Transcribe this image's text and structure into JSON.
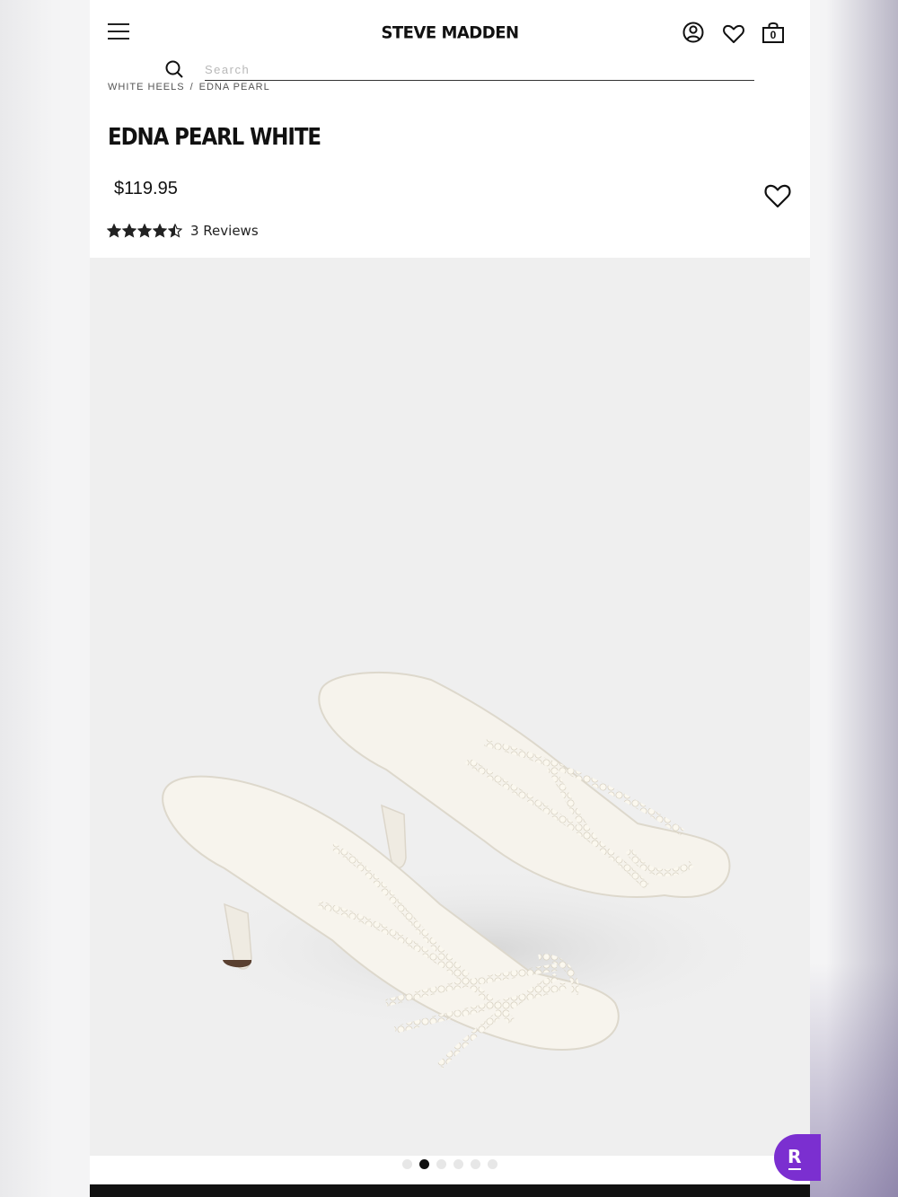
{
  "header": {
    "logo": "STEVE MADDEN",
    "bag_count": "0",
    "icons": [
      "menu-icon",
      "account-icon",
      "heart-icon",
      "shopping-bag-icon"
    ]
  },
  "search": {
    "placeholder": "Search",
    "value": ""
  },
  "breadcrumb": {
    "items": [
      "WHITE HEELS",
      "EDNA PEARL"
    ],
    "separator": "/"
  },
  "product": {
    "title": "EDNA PEARL WHITE",
    "price": "$119.95",
    "rating_value": 4.5,
    "rating_max": 5,
    "reviews_label": "3 Reviews"
  },
  "gallery": {
    "image_count": 6,
    "active_index": 1
  },
  "rewards": {
    "label": "R",
    "color": "#7b2fd0"
  },
  "colors": {
    "text": "#111111",
    "gallery_bg": "#efefef",
    "accent": "#7b2fd0"
  }
}
